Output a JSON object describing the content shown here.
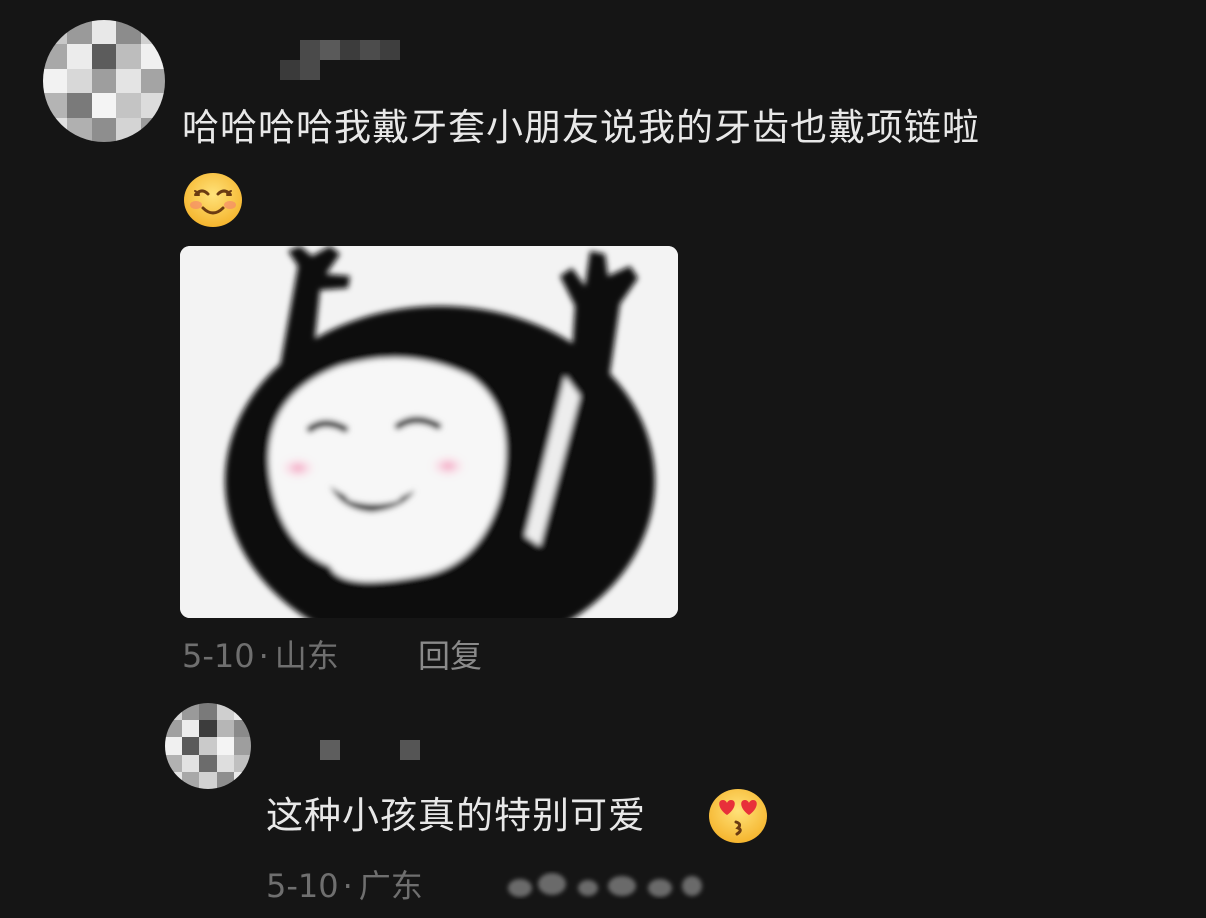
{
  "comment": {
    "text": "哈哈哈哈我戴牙套小朋友说我的牙齿也戴项链啦",
    "emoji": "smiling-face-with-closed-eyes",
    "sticker": "meme-sticker-cheering-face",
    "date": "5-10",
    "separator": "·",
    "location": "山东",
    "reply_label": "回复"
  },
  "reply": {
    "text": "这种小孩真的特别可爱",
    "emoji": "face-blowing-kiss-heart-eyes",
    "date": "5-10",
    "separator": "·",
    "location": "广东"
  },
  "colors": {
    "background": "#151515",
    "text": "#e8e8e8",
    "meta": "#6f6f6f"
  }
}
